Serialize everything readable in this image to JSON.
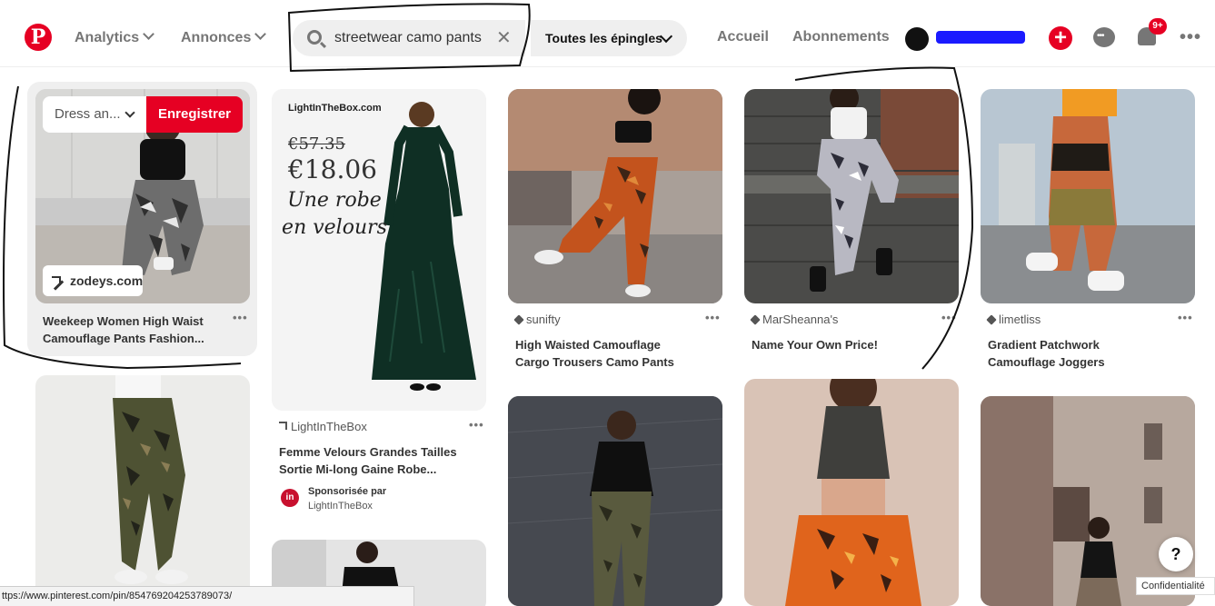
{
  "header": {
    "logo_letter": "P",
    "nav_analytics": "Analytics",
    "nav_annonces": "Annonces",
    "search_value": "streetwear camo pants",
    "clear_symbol": "✕",
    "scope_label": "Toutes les épingles",
    "home_link": "Accueil",
    "following_link": "Abonnements",
    "add_symbol": "+",
    "notif_badge": "9+",
    "more_symbol": "•••"
  },
  "hovered_pin": {
    "board_select": "Dress an...",
    "save_label": "Enregistrer",
    "link_label": "zodeys.com",
    "title_line1": "Weekeep Women High Waist",
    "title_line2": "Camouflage Pants Fashion...",
    "dots": "•••"
  },
  "ad_pin": {
    "brand": "LightInTheBox.com",
    "old_price": "€57.35",
    "new_price": "€18.06",
    "tagline": "Une robe en velours",
    "source": "LightInTheBox",
    "title_line1": "Femme Velours Grandes Tailles",
    "title_line2": "Sortie Mi-long Gaine Robe...",
    "sponsored_label": "Sponsorisée par",
    "sponsor_name": "LightInTheBox",
    "sponsor_logo": "in",
    "dots": "•••"
  },
  "pins": [
    {
      "source": "sunifty",
      "title_line1": "High Waisted Camouflage",
      "title_line2": "Cargo Trousers Camo Pants",
      "dots": "•••"
    },
    {
      "source": "MarSheanna's",
      "title_line1": "Name Your Own Price!",
      "title_line2": "",
      "dots": "•••"
    },
    {
      "source": "limetliss",
      "title_line1": "Gradient Patchwork",
      "title_line2": "Camouflage Joggers",
      "dots": "•••"
    }
  ],
  "status_url": "ttps://www.pinterest.com/pin/854769204253789073/",
  "help_symbol": "?",
  "privacy_label": "Confidentialité",
  "colors": {
    "brand_red": "#e60023",
    "redaction_blue": "#1a1aff",
    "gray_text": "#767676"
  }
}
